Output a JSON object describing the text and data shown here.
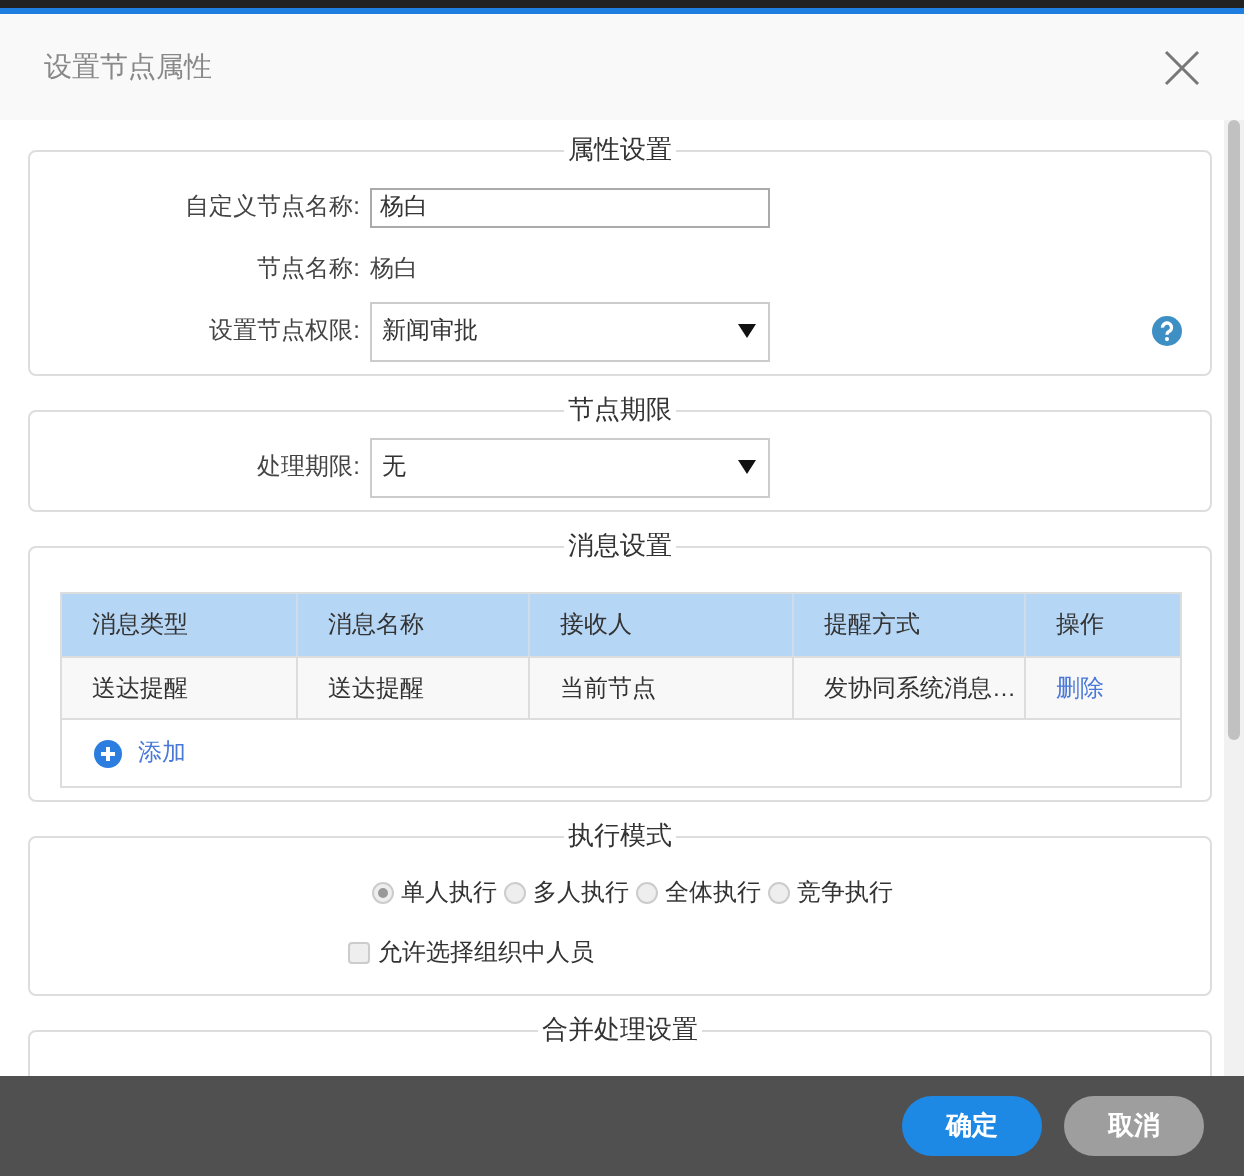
{
  "dialog": {
    "title": "设置节点属性"
  },
  "sections": [
    {
      "kind": "form",
      "title": "属性设置",
      "fields": [
        {
          "kind": "input",
          "label": "自定义节点名称:",
          "value": "杨白",
          "help": false
        },
        {
          "kind": "text",
          "label": "节点名称:",
          "value": "杨白",
          "help": false
        },
        {
          "kind": "select",
          "label": "设置节点权限:",
          "value": "新闻审批",
          "help": true
        }
      ]
    },
    {
      "kind": "form",
      "title": "节点期限",
      "fields": [
        {
          "kind": "select",
          "label": "处理期限:",
          "value": "无",
          "help": false
        }
      ]
    },
    {
      "kind": "table",
      "title": "消息设置",
      "columns": [
        "消息类型",
        "消息名称",
        "接收人",
        "提醒方式",
        "操作"
      ],
      "rows": [
        {
          "cells": [
            "送达提醒",
            "送达提醒",
            "当前节点",
            "发协同系统消息…"
          ],
          "action": "删除"
        }
      ],
      "add_label": "添加"
    },
    {
      "kind": "mode",
      "title": "执行模式",
      "options": [
        {
          "label": "单人执行",
          "selected": true
        },
        {
          "label": "多人执行",
          "selected": false
        },
        {
          "label": "全体执行",
          "selected": false
        },
        {
          "label": "竞争执行",
          "selected": false
        }
      ],
      "checkbox": {
        "label": "允许选择组织中人员",
        "checked": false
      }
    },
    {
      "kind": "collapsed",
      "title": "合并处理设置"
    }
  ],
  "buttons": [
    {
      "label": "确定",
      "kind": "primary"
    },
    {
      "label": "取消",
      "kind": "secondary"
    }
  ]
}
